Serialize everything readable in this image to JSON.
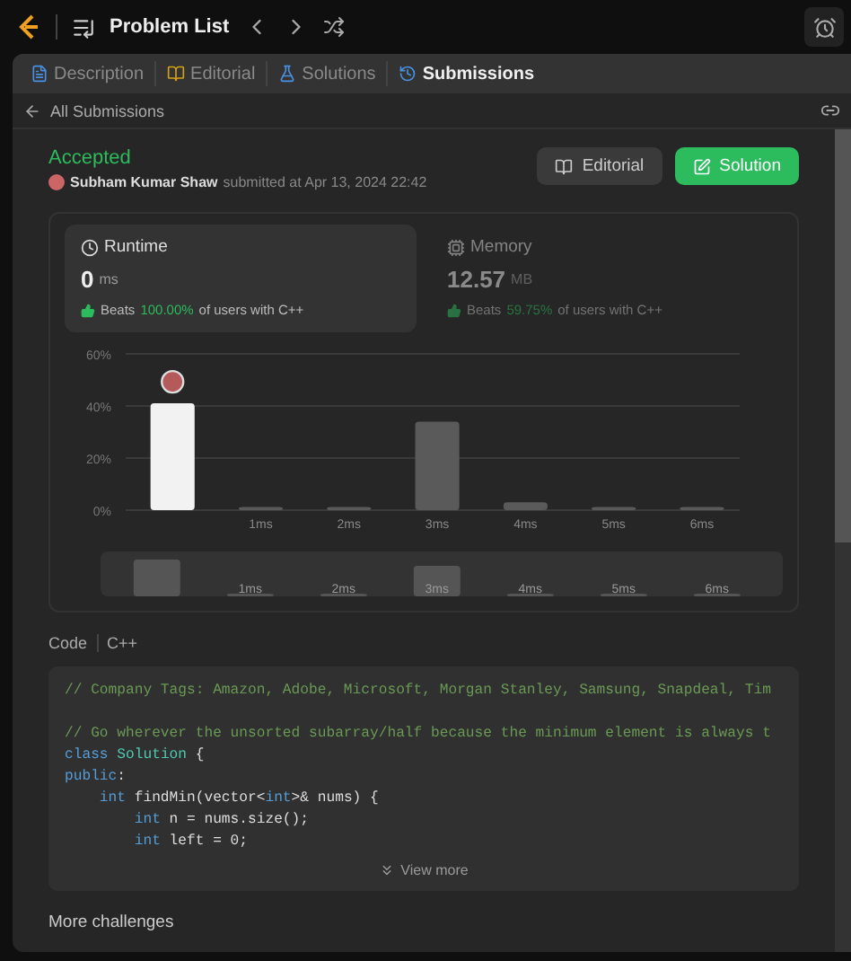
{
  "top_bar": {
    "title": "Problem List"
  },
  "tabs": [
    {
      "label": "Description",
      "selected": false
    },
    {
      "label": "Editorial",
      "selected": false
    },
    {
      "label": "Solutions",
      "selected": false
    },
    {
      "label": "Submissions",
      "selected": true
    }
  ],
  "back_link": "All Submissions",
  "submission": {
    "status": "Accepted",
    "author": "Subham Kumar Shaw",
    "submitted": "submitted at Apr 13, 2024 22:42"
  },
  "buttons": [
    {
      "label": "Editorial",
      "kind": "secondary"
    },
    {
      "label": "Solution",
      "kind": "primary"
    }
  ],
  "stats": [
    {
      "kind": "runtime",
      "label": "Runtime",
      "value": "0",
      "unit": "ms",
      "beats": "Beats",
      "percent": "100.00%",
      "suffix": "of users with C++",
      "selected": true
    },
    {
      "kind": "memory",
      "label": "Memory",
      "value": "12.57",
      "unit": "MB",
      "beats": "Beats",
      "percent": "59.75%",
      "suffix": "of users with C++",
      "selected": false
    }
  ],
  "chart_data": {
    "type": "bar",
    "categories": [
      null,
      "1ms",
      "2ms",
      "3ms",
      "4ms",
      "5ms",
      "6ms"
    ],
    "stacked": true,
    "series": [
      {
        "color": "#f2f2f2",
        "values": [
          41,
          null,
          null,
          null,
          null,
          null,
          null
        ]
      },
      {
        "color": "#5a5a5a",
        "values": [
          null,
          1,
          1,
          34,
          3,
          1,
          1
        ]
      }
    ],
    "ylim": [
      0,
      60
    ],
    "yticks": [
      {
        "value": 0,
        "label": "0%"
      },
      {
        "value": 20,
        "label": "20%"
      },
      {
        "value": 40,
        "label": "40%"
      },
      {
        "value": 60,
        "label": "60%"
      }
    ]
  },
  "range_selector": {
    "labels": [
      "1ms",
      "2ms",
      "3ms",
      "4ms",
      "5ms",
      "6ms"
    ]
  },
  "code": {
    "label": "Code",
    "language": "C++",
    "view_more": "View more",
    "lines": [
      {
        "kind": "code",
        "tokens": [
          {
            "kind": "comment",
            "text": "// Company Tags: Amazon, Adobe, Microsoft, Morgan Stanley, Samsung, Snapdeal, Tim"
          }
        ]
      },
      {
        "kind": "blank"
      },
      {
        "kind": "code",
        "tokens": [
          {
            "kind": "comment",
            "text": "// Go wherever the unsorted subarray/half because the minimum element is always t"
          }
        ]
      },
      {
        "kind": "code",
        "tokens": [
          {
            "kind": "keyword",
            "text": "class "
          },
          {
            "kind": "type",
            "text": "Solution"
          },
          {
            "kind": "plain",
            "text": " {"
          }
        ]
      },
      {
        "kind": "code",
        "tokens": [
          {
            "kind": "keyword",
            "text": "public"
          },
          {
            "kind": "plain",
            "text": ":"
          }
        ]
      },
      {
        "kind": "code",
        "tokens": [
          {
            "kind": "keyword",
            "text": "    int"
          },
          {
            "kind": "plain",
            "text": " findMin(vector<"
          },
          {
            "kind": "keyword",
            "text": "int"
          },
          {
            "kind": "plain",
            "text": ">& nums) {"
          }
        ]
      },
      {
        "kind": "code",
        "tokens": [
          {
            "kind": "keyword",
            "text": "        int"
          },
          {
            "kind": "plain",
            "text": " n = nums.size();"
          }
        ]
      },
      {
        "kind": "code",
        "tokens": [
          {
            "kind": "keyword",
            "text": "        int"
          },
          {
            "kind": "plain",
            "text": " left = 0;"
          }
        ]
      }
    ]
  },
  "more_challenges": "More challenges"
}
